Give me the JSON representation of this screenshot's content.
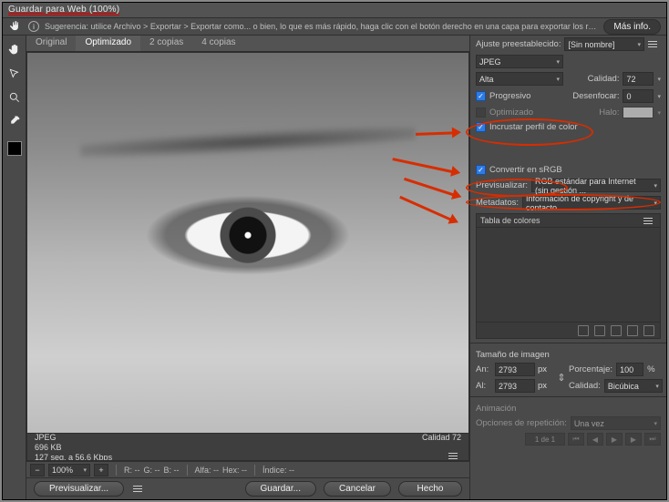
{
  "window": {
    "title": "Guardar para Web (100%)"
  },
  "hintbar": {
    "message": "Sugerencia: utilice Archivo > Exportar > Exportar como... o bien, lo que es más rápido, haga clic con el botón derecho en una capa para exportar los recursos",
    "more_info": "Más info."
  },
  "tabs": {
    "original": "Original",
    "optimized": "Optimizado",
    "two_up": "2 copias",
    "four_up": "4 copias"
  },
  "preview_status": {
    "format": "JPEG",
    "filesize": "696 KB",
    "time": "127 seg. a 56,6 Kbps",
    "quality_label": "Calidad 72"
  },
  "zoombar": {
    "zoom": "100%",
    "r": "R: --",
    "g": "G: --",
    "b": "B: --",
    "alfa": "Alfa: --",
    "hex": "Hex: --",
    "indice": "Índice: --"
  },
  "footer": {
    "preview": "Previsualizar...",
    "save": "Guardar...",
    "cancel": "Cancelar",
    "done": "Hecho"
  },
  "settings": {
    "preset_label": "Ajuste preestablecido:",
    "preset_value": "[Sin nombre]",
    "format": "JPEG",
    "quality_preset": "Alta",
    "quality_label": "Calidad:",
    "quality_value": "72",
    "progressive": "Progresivo",
    "optimized": "Optimizado",
    "blur_label": "Desenfocar:",
    "blur_value": "0",
    "matte_label": "Halo:",
    "embed_profile": "Incrustar perfil de color",
    "convert_srgb": "Convertir en sRGB",
    "preview_label": "Previsualizar:",
    "preview_value": "RGB estándar para Internet (sin gestión ...",
    "metadata_label": "Metadatos:",
    "metadata_value": "Información de copyright y de contacto",
    "color_table": "Tabla de colores",
    "image_size": {
      "title": "Tamaño de imagen",
      "w_label": "An:",
      "w_value": "2793",
      "h_label": "Al:",
      "h_value": "2793",
      "px": "px",
      "percent_label": "Porcentaje:",
      "percent_value": "100",
      "percent_sign": "%",
      "quality_label": "Calidad:",
      "quality_value": "Bicúbica"
    },
    "animation": {
      "title": "Animación",
      "loop_label": "Opciones de repetición:",
      "loop_value": "Una vez",
      "frame": "1 de 1"
    }
  }
}
